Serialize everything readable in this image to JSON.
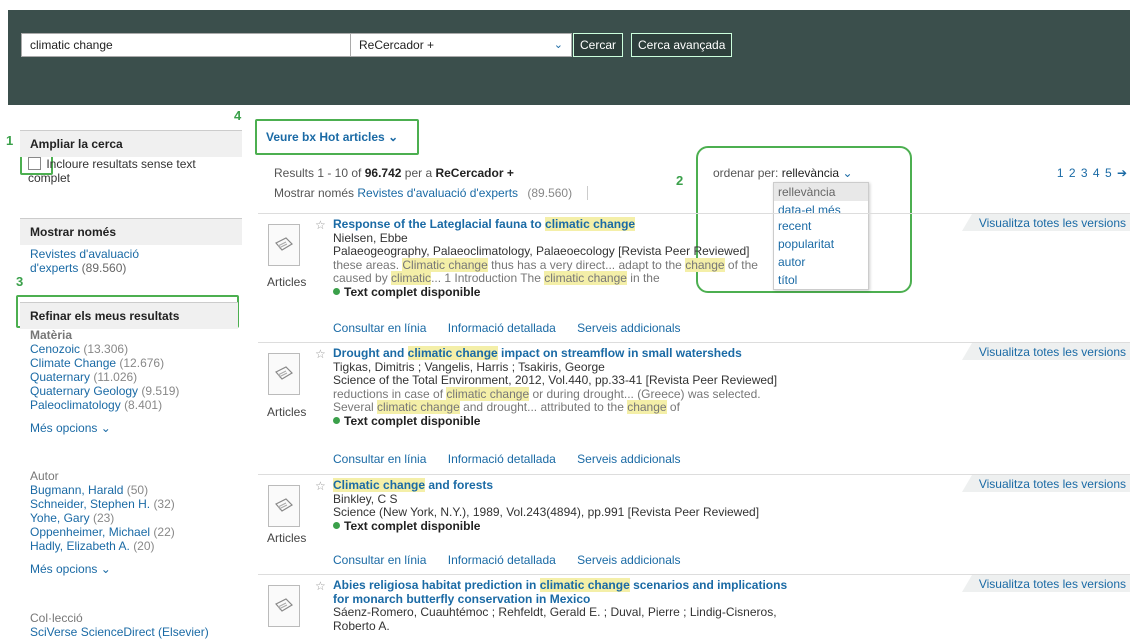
{
  "header": {
    "search_value": "climatic change",
    "scope_value": "ReCercador +",
    "search_button": "Cercar",
    "advanced_button": "Cerca avançada"
  },
  "annotations": [
    "1",
    "2",
    "3",
    "4"
  ],
  "sidebar": {
    "expand_title": "Ampliar la cerca",
    "include_label": "Incloure resultats sense text complet",
    "show_only_title": "Mostrar només",
    "peer_reviewed": "Revistes d'avaluació d'experts",
    "peer_reviewed_count": "(89.560)",
    "refine_title": "Refinar els meus resultats",
    "subject_label": "Matèria",
    "subjects": [
      {
        "label": "Cenozoic",
        "count": "(13.306)"
      },
      {
        "label": "Climate Change",
        "count": "(12.676)"
      },
      {
        "label": "Quaternary",
        "count": "(11.026)"
      },
      {
        "label": "Quaternary Geology",
        "count": "(9.519)"
      },
      {
        "label": "Paleoclimatology",
        "count": "(8.401)"
      }
    ],
    "more_options": "Més opcions",
    "author_label": "Autor",
    "authors": [
      {
        "label": "Bugmann, Harald",
        "count": "(50)"
      },
      {
        "label": "Schneider, Stephen H.",
        "count": "(32)"
      },
      {
        "label": "Yohe, Gary",
        "count": "(23)"
      },
      {
        "label": "Oppenheimer, Michael",
        "count": "(22)"
      },
      {
        "label": "Hadly, Elizabeth A.",
        "count": "(20)"
      }
    ],
    "collection_label": "Col·lecció",
    "collection_first": "SciVerse ScienceDirect (Elsevier)"
  },
  "main": {
    "hot_articles": "Veure bx Hot articles",
    "results_prefix": "Results 1 - 10 of",
    "results_total": "96.742",
    "results_for": "per a",
    "results_scope": "ReCercador +",
    "show_only": "Mostrar només",
    "peer_filter": "Revistes d'avaluació d'experts",
    "peer_filter_count": "(89.560)",
    "sort_label": "ordenar per:",
    "sort_value": "rellevància",
    "sort_options": [
      "rellevància",
      "data-el més recent",
      "popularitat",
      "autor",
      "títol"
    ],
    "pages": "1 2 3 4 5 ➔"
  },
  "result_common": {
    "type": "Articles",
    "versions": "Visualitza totes les versions",
    "available": "Text complet disponible",
    "action_online": "Consultar en línia",
    "action_details": "Informació detallada",
    "action_extra": "Serveis addicionals"
  },
  "results": [
    {
      "title_a": "Response of the Lateglacial fauna to ",
      "title_hl": "climatic change",
      "authors": "Nielsen, Ebbe",
      "source": "Palaeogeography, Palaeoclimatology, Palaeoecology [Revista Peer Reviewed]",
      "snip1_a": "these areas. ",
      "snip1_hl": "Climatic change",
      "snip1_b": " thus has a very direct... adapt to the ",
      "snip1_hl2": "change",
      "snip1_c": " of the",
      "snip2_a": "caused by ",
      "snip2_hl": "climatic",
      "snip2_b": "... 1 Introduction The ",
      "snip2_hl2": "climatic change",
      "snip2_c": " in the"
    },
    {
      "title_a": "Drought and ",
      "title_hl": "climatic change",
      "title_b": " impact on streamflow in small watersheds",
      "authors": "Tigkas, Dimitris ; Vangelis, Harris ; Tsakiris, George",
      "source": "Science of the Total Environment, 2012, Vol.440, pp.33-41 [Revista Peer Reviewed]",
      "snip1_a": "reductions in case of ",
      "snip1_hl": "climatic change",
      "snip1_b": " or during drought... (Greece) was selected.",
      "snip2_a": "Several ",
      "snip2_hl": "climatic change",
      "snip2_b": " and drought... attributed to the ",
      "snip2_hl2": "change",
      "snip2_c": " of"
    },
    {
      "title_hl": "Climatic change",
      "title_b": " and forests",
      "authors": "Binkley, C S",
      "source": "Science (New York, N.Y.), 1989, Vol.243(4894), pp.991 [Revista Peer Reviewed]"
    },
    {
      "title_a": "Abies religiosa habitat prediction in ",
      "title_hl": "climatic change",
      "title_b": " scenarios and implications",
      "title_c": "for monarch butterfly conservation in Mexico",
      "authors": "Sáenz-Romero, Cuauhtémoc ; Rehfeldt, Gerald E. ; Duval, Pierre ; Lindig-Cisneros,",
      "authors2": "Roberto A."
    }
  ]
}
